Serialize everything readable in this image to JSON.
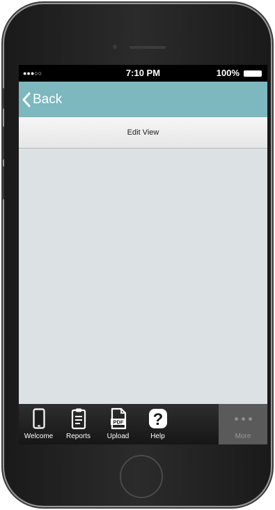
{
  "status_bar": {
    "signal": "●●●○○",
    "time": "7:10 PM",
    "battery": "100%"
  },
  "nav": {
    "back_label": "Back"
  },
  "toolbar": {
    "edit_view_label": "Edit View"
  },
  "tabs": [
    {
      "label": "Welcome",
      "icon": "phone-icon"
    },
    {
      "label": "Reports",
      "icon": "clipboard-icon"
    },
    {
      "label": "Upload",
      "icon": "pdf-file-icon"
    },
    {
      "label": "Help",
      "icon": "help-icon"
    },
    {
      "label": "More",
      "icon": "more-dots-icon"
    }
  ],
  "colors": {
    "navbar": "#7cb8be",
    "content_background": "#dce2e3",
    "tabbar": "#1e1e1e",
    "more_tab": "#5a5a5a"
  }
}
